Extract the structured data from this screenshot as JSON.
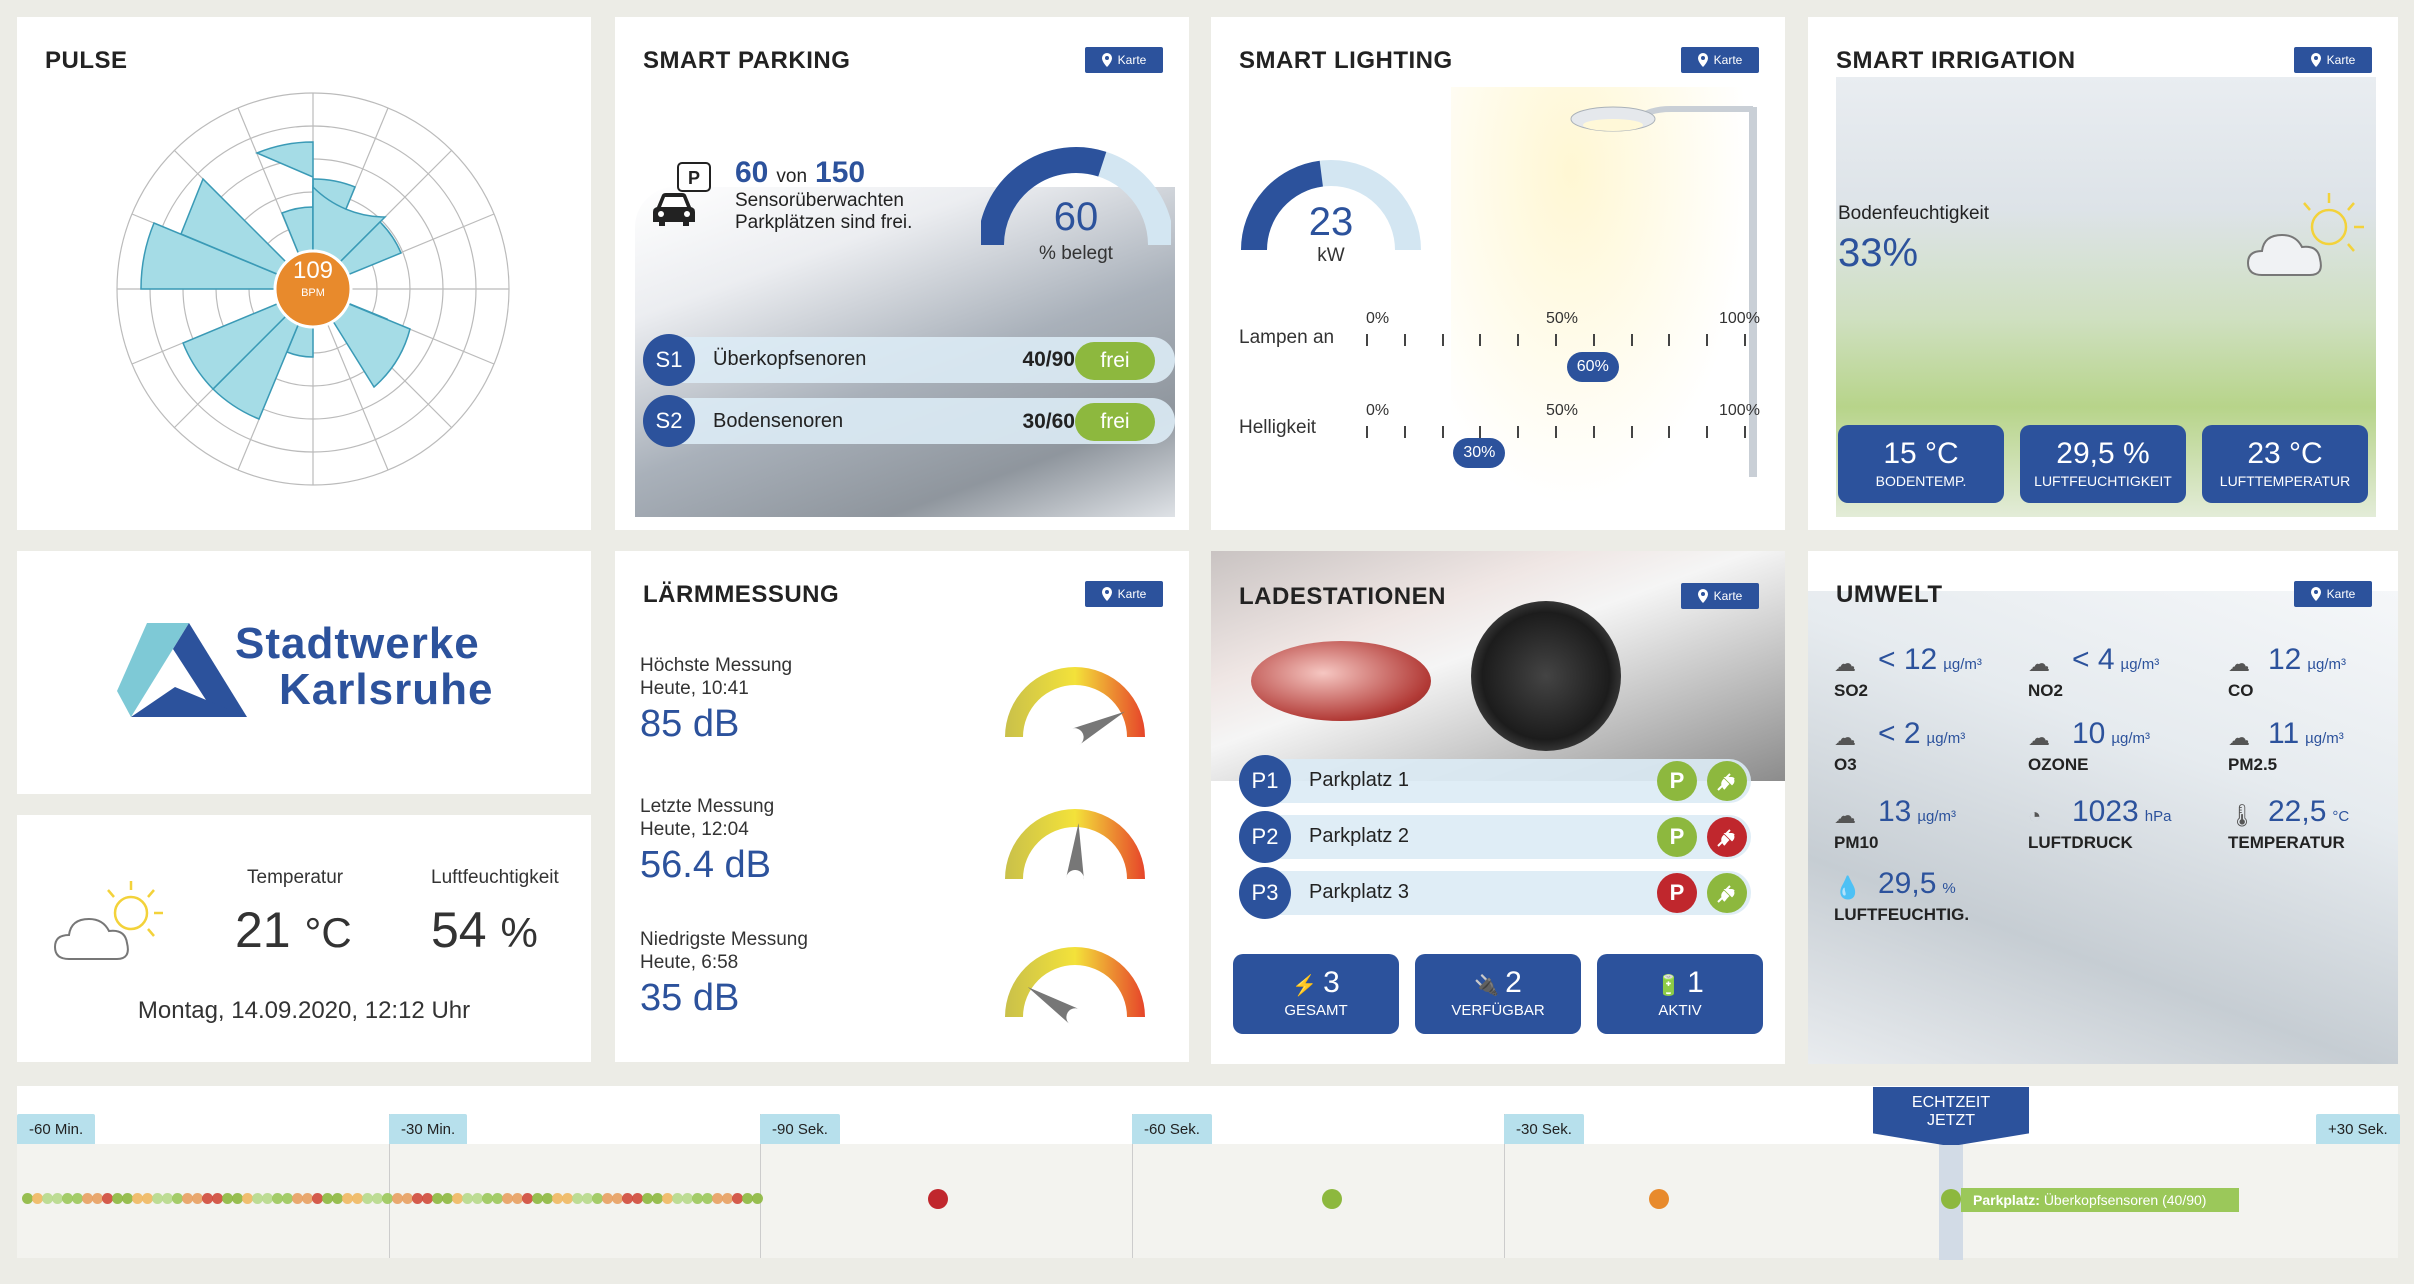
{
  "karte_label": "Karte",
  "pulse": {
    "title": "PULSE",
    "value": "109",
    "unit": "BPM"
  },
  "parking": {
    "title": "SMART PARKING",
    "free": "60",
    "von": "von",
    "total": "150",
    "desc1": "Sensorüberwachten",
    "desc2": "Parkplätzen sind frei.",
    "gauge_value": "60",
    "gauge_label": "% belegt",
    "occupancy_percent": 60,
    "rows": [
      {
        "id": "S1",
        "label": "Überkopfsenoren",
        "count": "40/90",
        "status": "frei"
      },
      {
        "id": "S2",
        "label": "Bodensenoren",
        "count": "30/60",
        "status": "frei"
      }
    ]
  },
  "lighting": {
    "title": "SMART LIGHTING",
    "kw_value": "23",
    "kw_unit": "kW",
    "kw_fraction": 0.46,
    "lampen_label": "Lampen an",
    "lampen_value": "60%",
    "lampen_percent": 60,
    "hell_label": "Helligkeit",
    "hell_value": "30%",
    "hell_percent": 30,
    "scale": [
      "0%",
      "50%",
      "100%"
    ]
  },
  "irrigation": {
    "title": "SMART IRRIGATION",
    "label": "Bodenfeuchtigkeit",
    "value": "33%",
    "stats": [
      {
        "value": "15 °C",
        "label": "BODENTEMP."
      },
      {
        "value": "29,5 %",
        "label": "LUFTFEUCHTIGKEIT"
      },
      {
        "value": "23 °C",
        "label": "LUFTTEMPERATUR"
      }
    ]
  },
  "logo": {
    "line1": "Stadtwerke",
    "line2": "Karlsruhe"
  },
  "weather": {
    "temp_label": "Temperatur",
    "temp_value": "21",
    "temp_unit": "°C",
    "hum_label": "Luftfeuchtigkeit",
    "hum_value": "54",
    "hum_unit": "%",
    "datetime": "Montag, 14.09.2020, 12:12 Uhr"
  },
  "noise": {
    "title": "LÄRMMESSUNG",
    "items": [
      {
        "label": "Höchste Messung",
        "time": "Heute, 10:41",
        "value": "85 dB",
        "level": 0.85
      },
      {
        "label": "Letzte Messung",
        "time": "Heute, 12:04",
        "value": "56.4 dB",
        "level": 0.52
      },
      {
        "label": "Niedrigste Messung",
        "time": "Heute, 6:58",
        "value": "35 dB",
        "level": 0.18
      }
    ]
  },
  "charging": {
    "title": "LADESTATIONEN",
    "spots": [
      {
        "id": "P1",
        "label": "Parkplatz 1",
        "p": "green",
        "plug": "green"
      },
      {
        "id": "P2",
        "label": "Parkplatz 2",
        "p": "green",
        "plug": "red"
      },
      {
        "id": "P3",
        "label": "Parkplatz 3",
        "p": "red",
        "plug": "green"
      }
    ],
    "stats": [
      {
        "value": "3",
        "label": "GESAMT"
      },
      {
        "value": "2",
        "label": "VERFÜGBAR"
      },
      {
        "value": "1",
        "label": "AKTIV"
      }
    ]
  },
  "umwelt": {
    "title": "UMWELT",
    "items": [
      {
        "value": "< 12",
        "unit": "µg/m³",
        "name": "SO2",
        "tag": "SO₂"
      },
      {
        "value": "< 4",
        "unit": "µg/m³",
        "name": "NO2",
        "tag": "NO₂"
      },
      {
        "value": "12",
        "unit": "µg/m³",
        "name": "CO",
        "tag": "CO"
      },
      {
        "value": "< 2",
        "unit": "µg/m³",
        "name": "O3",
        "tag": "O₃"
      },
      {
        "value": "10",
        "unit": "µg/m³",
        "name": "OZONE",
        "tag": "O₃"
      },
      {
        "value": "11",
        "unit": "µg/m³",
        "name": "PM2.5",
        "tag": "PM2.5"
      },
      {
        "value": "13",
        "unit": "µg/m³",
        "name": "PM10",
        "tag": "PM10"
      },
      {
        "value": "1023",
        "unit": "hPa",
        "name": "LUFTDRUCK"
      },
      {
        "value": "22,5",
        "unit": "°C",
        "name": "TEMPERATUR"
      },
      {
        "value": "29,5",
        "unit": "%",
        "name": "LUFTFEUCHTIG."
      }
    ]
  },
  "timeline": {
    "labels": [
      "-60 Min.",
      "-30 Min.",
      "-90 Sek.",
      "-60 Sek.",
      "-30 Sek.",
      "+30 Sek."
    ],
    "now_line1": "ECHTZEIT",
    "now_line2": "JETZT",
    "event_bold": "Parkplatz:",
    "event_text": "Überkopfsensoren (40/90)"
  }
}
